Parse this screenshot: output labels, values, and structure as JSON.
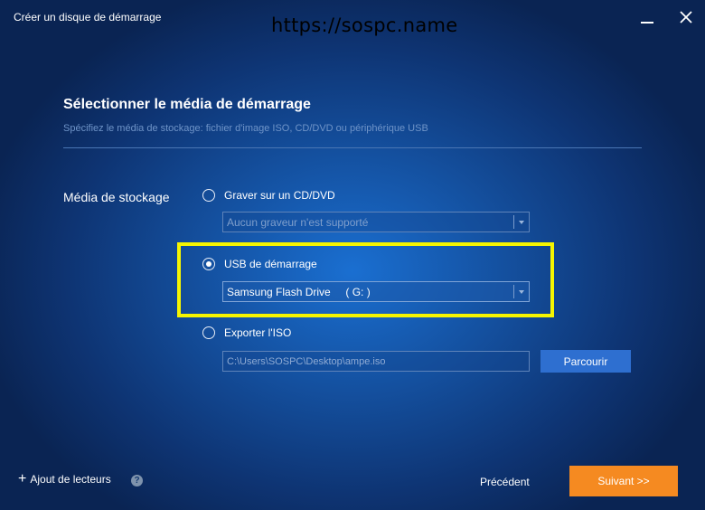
{
  "window": {
    "title": "Créer un disque de démarrage",
    "watermark": "https://sospc.name"
  },
  "header": {
    "title": "Sélectionner le média de démarrage",
    "subtitle": "Spécifiez le média de stockage: fichier d'image ISO, CD/DVD ou périphérique USB"
  },
  "storage": {
    "label": "Média de stockage",
    "options": [
      {
        "label": "Graver sur un CD/DVD",
        "checked": false,
        "select_value": "Aucun graveur n'est supporté",
        "disabled": true
      },
      {
        "label": "USB de démarrage",
        "checked": true,
        "select_value": "Samsung Flash Drive     ( G: )",
        "disabled": false
      },
      {
        "label": "Exporter l'ISO",
        "checked": false,
        "path_value": "C:\\Users\\SOSPC\\Desktop\\ampe.iso",
        "browse_label": "Parcourir"
      }
    ]
  },
  "footer": {
    "add_drivers_label": "Ajout de lecteurs",
    "help_glyph": "?",
    "back_label": "Précédent",
    "next_label": "Suivant >>"
  },
  "colors": {
    "accent_button": "#f58a21",
    "browse_button": "#2e6fd0",
    "highlight": "#f6f500"
  },
  "icons": [
    "minimize-icon",
    "close-icon",
    "plus-icon",
    "help-icon",
    "dropdown-arrow-icon"
  ]
}
